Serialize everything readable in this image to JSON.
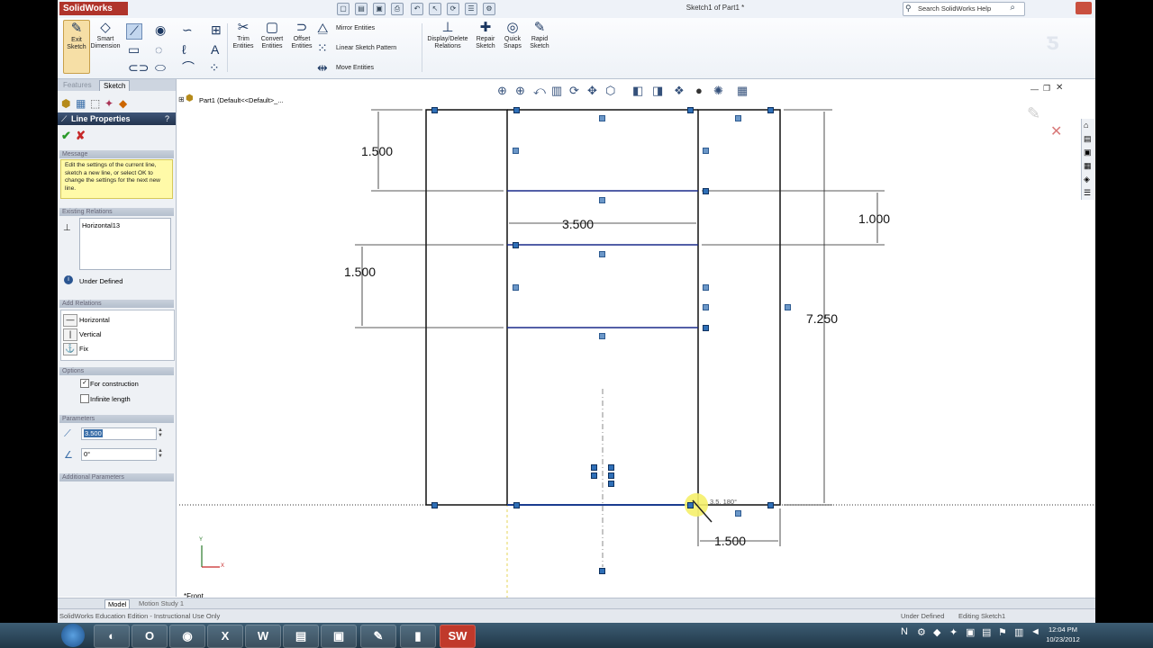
{
  "app": {
    "name": "SolidWorks",
    "doc_title": "Sketch1 of Part1 *",
    "search_placeholder": "Search SolidWorks Help"
  },
  "ribbon": {
    "exit_sketch": "Exit Sketch",
    "smart_dimension": "Smart Dimension",
    "trim_entities": "Trim Entities",
    "convert_entities": "Convert Entities",
    "offset_entities": "Offset Entities",
    "mirror_entities": "Mirror Entities",
    "linear_sketch_pattern": "Linear Sketch Pattern",
    "move_entities": "Move Entities",
    "display_delete_relations": "Display/Delete Relations",
    "repair_sketch": "Repair Sketch",
    "quick_snaps": "Quick Snaps",
    "rapid_sketch": "Rapid Sketch"
  },
  "panel": {
    "tab_features": "Features",
    "tab_sketch": "Sketch",
    "title": "Line Properties",
    "help_icon": "?",
    "message_header": "Message",
    "message": "Edit the settings of the current line, sketch a new line, or select OK to change the settings for the next new line.",
    "existing_relations_header": "Existing Relations",
    "relation_item": "Horizontal13",
    "status": "Under Defined",
    "add_relations_header": "Add Relations",
    "relations": [
      "Horizontal",
      "Vertical",
      "Fix"
    ],
    "options_header": "Options",
    "for_construction": "For construction",
    "infinite_length": "Infinite length",
    "parameters_header": "Parameters",
    "length_value": "3.500",
    "angle_value": "0°",
    "additional_header": "Additional Parameters"
  },
  "tree": {
    "root": "Part1  (Default<<Default>_..."
  },
  "dimensions": {
    "d1": "1.500",
    "d2": "3.500",
    "d3": "1.000",
    "d4": "1.500",
    "d5": "7.250",
    "d6": "1.500",
    "cursor_hint": "3.5, 180°"
  },
  "view": {
    "name": "*Front",
    "axis_x": "X",
    "axis_y": "Y"
  },
  "tabs_bottom": {
    "model": "Model",
    "motion": "Motion Study 1"
  },
  "statusbar": {
    "left": "SolidWorks Education Edition - Instructional Use Only",
    "state": "Under Defined",
    "mode": "Editing Sketch1"
  },
  "clock": {
    "time": "12:04 PM",
    "date": "10/23/2012"
  }
}
